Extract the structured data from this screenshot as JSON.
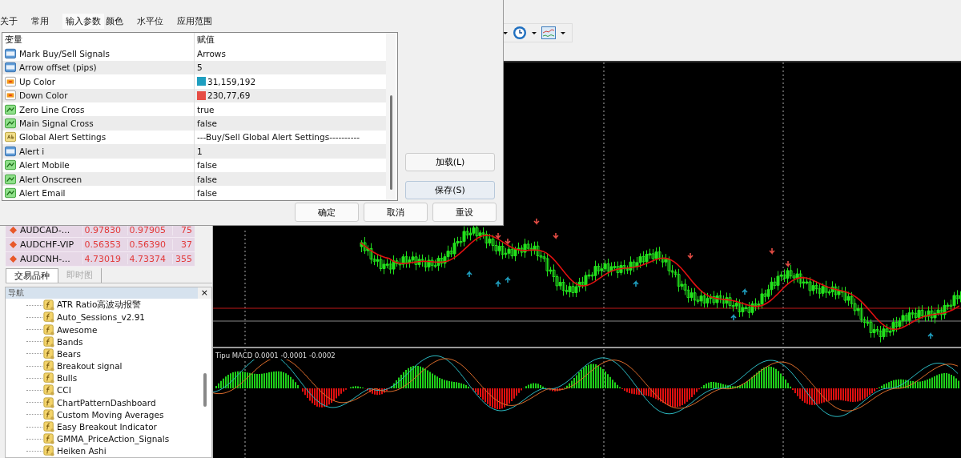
{
  "dialog": {
    "tabs": [
      {
        "label": "关于",
        "selected": false
      },
      {
        "label": "常用",
        "selected": false
      },
      {
        "label": "输入参数",
        "selected": true
      },
      {
        "label": "颜色",
        "selected": false
      },
      {
        "label": "水平位",
        "selected": false
      },
      {
        "label": "应用范围",
        "selected": false
      }
    ],
    "table": {
      "columns": [
        "变量",
        "赋值"
      ],
      "rows": [
        {
          "kind": "int",
          "name": "Mark Buy/Sell Signals",
          "value": "Arrows"
        },
        {
          "kind": "int",
          "name": "Arrow offset (pips)",
          "value": "5"
        },
        {
          "kind": "color",
          "name": "Up Color",
          "value": "31,159,192",
          "color": "#1f9fc0"
        },
        {
          "kind": "color",
          "name": "Down Color",
          "value": "230,77,69",
          "color": "#e64d45"
        },
        {
          "kind": "bool",
          "name": "Zero Line Cross",
          "value": "true"
        },
        {
          "kind": "bool",
          "name": "Main Signal Cross",
          "value": "false"
        },
        {
          "kind": "string",
          "name": "Global Alert Settings",
          "value": "---Buy/Sell Global Alert Settings----------"
        },
        {
          "kind": "int",
          "name": "Alert i",
          "value": "1"
        },
        {
          "kind": "bool",
          "name": "Alert Mobile",
          "value": "false"
        },
        {
          "kind": "bool",
          "name": "Alert Onscreen",
          "value": "false"
        },
        {
          "kind": "bool",
          "name": "Alert Email",
          "value": "false"
        }
      ]
    },
    "side_buttons": [
      "加载(L)",
      "保存(S)"
    ],
    "buttons": [
      "确定",
      "取消",
      "重设"
    ]
  },
  "market_watch": {
    "rows": [
      {
        "symbol": "AUDCAD-...",
        "bid": "0.97830",
        "ask": "0.97905",
        "spread": "75"
      },
      {
        "symbol": "AUDCHF-VIP",
        "bid": "0.56353",
        "ask": "0.56390",
        "spread": "37"
      },
      {
        "symbol": "AUDCNH-...",
        "bid": "4.73019",
        "ask": "4.73374",
        "spread": "355"
      }
    ],
    "tabs": [
      {
        "label": "交易品种",
        "selected": true
      },
      {
        "label": "即时图",
        "selected": false
      }
    ]
  },
  "navigator": {
    "title": "导航",
    "close": "×",
    "items": [
      "ATR Ratio高波动报警",
      "Auto_Sessions_v2.91",
      "Awesome",
      "Bands",
      "Bears",
      "Breakout signal",
      "Bulls",
      "CCI",
      "ChartPatternDashboard",
      "Custom Moving Averages",
      "Easy Breakout Indicator",
      "GMMA_PriceAction_Signals",
      "Heiken Ashi"
    ]
  },
  "chart": {
    "macd_label": "Tipu MACD 0.0001 -0.0001 -0.0002"
  }
}
